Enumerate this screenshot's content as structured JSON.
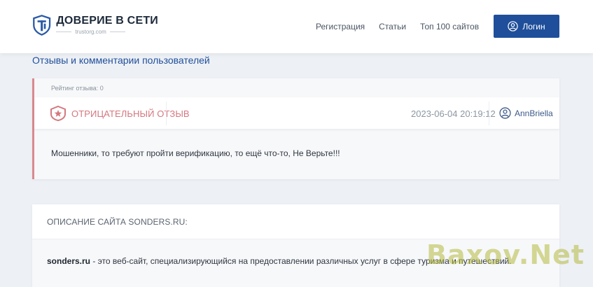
{
  "header": {
    "logo_title": "ДОВЕРИЕ В СЕТИ",
    "logo_subtitle": "trustorg.com",
    "nav": [
      "Регистрация",
      "Статьи",
      "Топ 100 сайтов"
    ],
    "login_label": "Логин"
  },
  "section_title": "Отзывы и комментарии пользователей",
  "review": {
    "rating_text": "Рейтинг отзыва: 0",
    "type_label": "ОТРИЦАТЕЛЬНЫЙ ОТЗЫВ",
    "date": "2023-06-04 20:19:12",
    "author": "AnnBriella",
    "text": "Мошенники, то требуют пройти верификацию, то ещё что-то, Не Верьте!!!"
  },
  "description": {
    "title": "ОПИСАНИЕ САЙТА SONDERS.RU:",
    "site_name": "sonders.ru",
    "text": " - это веб-сайт, специализирующийся на предоставлении различных услуг в сфере туризма и путешествий."
  },
  "watermark": "Baxov.Net",
  "colors": {
    "accent": "#1f4f9a",
    "negative": "#d4787f",
    "background": "#edf0f5"
  },
  "icons": [
    "logo-shield-icon",
    "user-icon",
    "negative-star-icon",
    "author-user-icon"
  ]
}
